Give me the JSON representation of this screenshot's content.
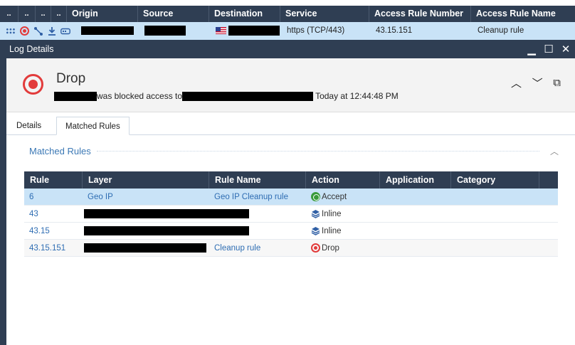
{
  "grid": {
    "headers": [
      "..",
      "..",
      "..",
      "..",
      "Origin",
      "Source",
      "Destination",
      "Service",
      "Access Rule Number",
      "Access Rule Name"
    ],
    "row": {
      "service": "https (TCP/443)",
      "rule_number": "43.15.151",
      "rule_name": "Cleanup rule"
    }
  },
  "window": {
    "title": "Log Details",
    "minimize": "▁",
    "maximize": "☐",
    "close": "✕"
  },
  "summary": {
    "action": "Drop",
    "message": "was blocked access to",
    "time": "Today at  12:44:48 PM",
    "prev": "︿",
    "next": "﹀",
    "copy": "⧉"
  },
  "tabs": [
    {
      "label": "Details"
    },
    {
      "label": "Matched Rules"
    }
  ],
  "matched": {
    "section_title": "Matched Rules",
    "collapse": "︿",
    "columns": [
      "Rule",
      "Layer",
      "Rule Name",
      "Action",
      "Application",
      "Category"
    ],
    "rows": [
      {
        "rule": "6",
        "layer": "Geo IP",
        "rule_name": "Geo IP Cleanup rule",
        "action": "Accept"
      },
      {
        "rule": "43",
        "layer": "",
        "rule_name": "",
        "action": "Inline"
      },
      {
        "rule": "43.15",
        "layer": "",
        "rule_name": "",
        "action": "Inline"
      },
      {
        "rule": "43.15.151",
        "layer": "",
        "rule_name": "Cleanup rule",
        "action": "Drop"
      }
    ]
  },
  "colors": {
    "header_bg": "#2f3e53",
    "selection": "#c9e3f7",
    "link": "#2e6db3",
    "drop_red": "#e23b3b",
    "accept_green": "#3a9b3a"
  }
}
